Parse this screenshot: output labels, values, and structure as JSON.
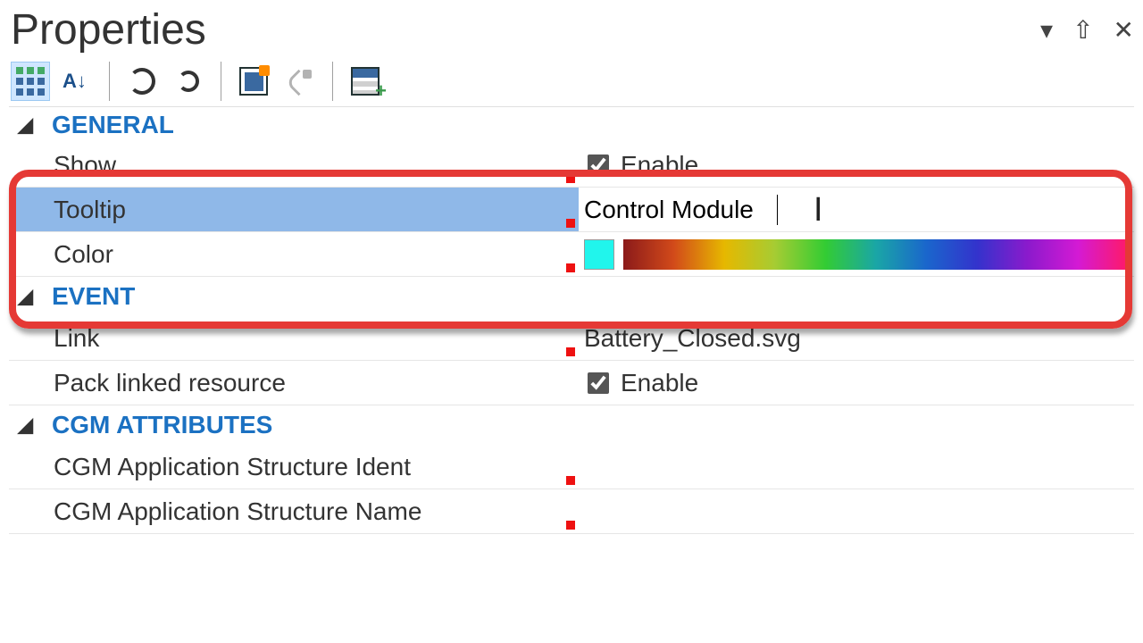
{
  "panel": {
    "title": "Properties"
  },
  "categories": {
    "general": {
      "header": "GENERAL",
      "show": {
        "label": "Show",
        "enable_label": "Enable",
        "checked": true
      },
      "tooltip": {
        "label": "Tooltip",
        "value": "Control Module"
      },
      "color": {
        "label": "Color",
        "swatch": "#21f5ec"
      }
    },
    "event": {
      "header": "EVENT",
      "link": {
        "label": "Link",
        "value": "Battery_Closed.svg"
      },
      "pack": {
        "label": "Pack linked resource",
        "enable_label": "Enable",
        "checked": true
      }
    },
    "cgm": {
      "header": "CGM ATTRIBUTES",
      "ident": {
        "label": "CGM Application Structure Ident",
        "value": ""
      },
      "name": {
        "label": "CGM Application Structure Name",
        "value": ""
      }
    }
  },
  "toolbar": {
    "categorized": "Categorized",
    "sort": "A↓Z Sort",
    "refresh_linked": "Refresh linked",
    "refresh": "Refresh",
    "events": "Property events",
    "picker": "Pick from",
    "add": "Add property"
  }
}
